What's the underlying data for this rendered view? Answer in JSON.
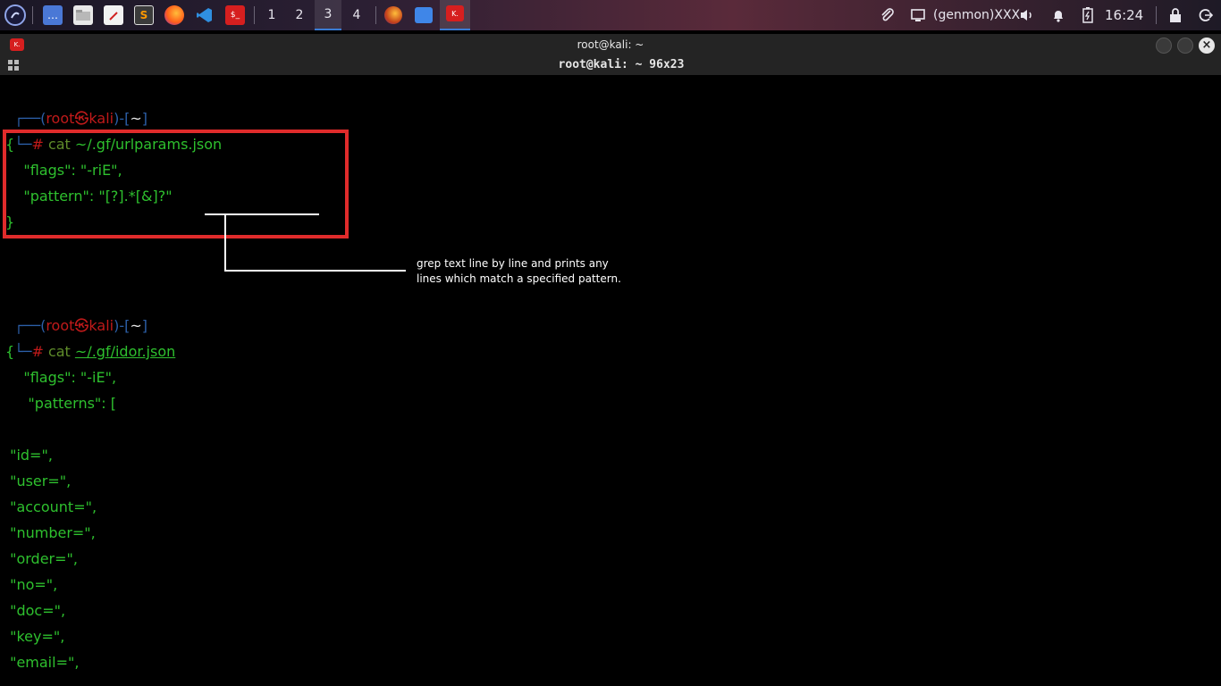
{
  "taskbar": {
    "workspaces": [
      "1",
      "2",
      "3",
      "4"
    ],
    "active_workspace": "3",
    "genmon": "(genmon)XXX",
    "clock": "16:24"
  },
  "window": {
    "title": "root@kali: ~",
    "size_label": "root@kali: ~ 96x23"
  },
  "terminal": {
    "prompt1": {
      "user": "root",
      "host": "kali",
      "dir": "~",
      "command": "cat",
      "arg": "~/.gf/urlparams.json"
    },
    "json1": [
      "{",
      "    \"flags\": \"-riE\",",
      "    \"pattern\": \"[?].*[&]?\"",
      "}"
    ],
    "prompt2": {
      "user": "root",
      "host": "kali",
      "dir": "~",
      "command": "cat",
      "arg": "~/.gf/idor.json"
    },
    "json2_head": [
      "{",
      "    \"flags\": \"-iE\",",
      "     \"patterns\": ["
    ],
    "json2_items": [
      " \"id=\",",
      " \"user=\",",
      " \"account=\",",
      " \"number=\",",
      " \"order=\",",
      " \"no=\",",
      " \"doc=\",",
      " \"key=\",",
      " \"email=\","
    ]
  },
  "annotation": {
    "line1": "grep text line by line and prints any",
    "line2": "lines which match a specified pattern."
  },
  "colors": {
    "terminal_text": "#2ec02e",
    "prompt_red": "#c01a1a",
    "prompt_blue": "#2c5fa8",
    "highlight": "#e02b2b"
  }
}
